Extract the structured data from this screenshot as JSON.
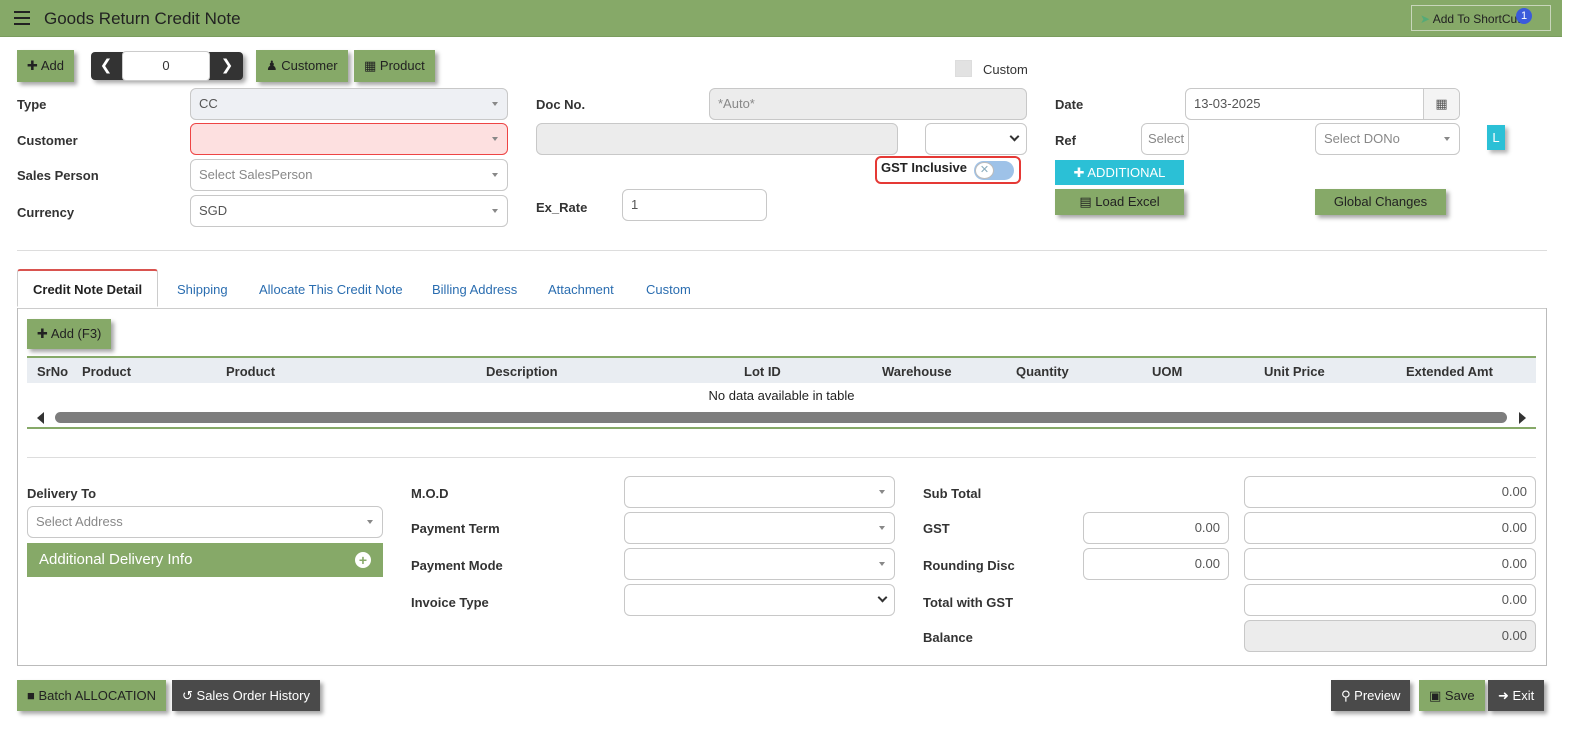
{
  "header": {
    "title": "Goods Return Credit Note",
    "shortcut_label": "Add To ShortCut",
    "shortcut_badge": "1"
  },
  "toolbar": {
    "add_label": "Add",
    "nav_value": "0",
    "customer_label": "Customer",
    "product_label": "Product",
    "custom_label": "Custom"
  },
  "form": {
    "type_label": "Type",
    "type_value": "CC",
    "customer_label": "Customer",
    "sales_person_label": "Sales Person",
    "sales_person_placeholder": "Select SalesPerson",
    "currency_label": "Currency",
    "currency_value": "SGD",
    "doc_no_label": "Doc No.",
    "doc_no_value": "*Auto*",
    "gst_inclusive_label": "GST Inclusive",
    "ex_rate_label": "Ex_Rate",
    "ex_rate_value": "1",
    "date_label": "Date",
    "date_value": "13-03-2025",
    "ref_label": "Ref",
    "ref_select_placeholder": "Select",
    "dono_placeholder": "Select DONo",
    "l_button": "L",
    "additional_label": "ADDITIONAL",
    "load_excel_label": "Load Excel",
    "global_changes_label": "Global Changes"
  },
  "tabs": [
    {
      "label": "Credit Note Detail",
      "active": true
    },
    {
      "label": "Shipping"
    },
    {
      "label": "Allocate This Credit Note"
    },
    {
      "label": "Billing Address"
    },
    {
      "label": "Attachment"
    },
    {
      "label": "Custom"
    }
  ],
  "detail": {
    "add_label": "Add (F3)",
    "columns": [
      "SrNo",
      "Product",
      "Product",
      "Description",
      "Lot ID",
      "Warehouse",
      "Quantity",
      "UOM",
      "Unit Price",
      "Extended Amt"
    ],
    "empty_text": "No data available in table"
  },
  "footer": {
    "delivery_to_label": "Delivery To",
    "address_placeholder": "Select Address",
    "additional_delivery_label": "Additional Delivery Info",
    "mod_label": "M.O.D",
    "payment_term_label": "Payment Term",
    "payment_mode_label": "Payment Mode",
    "invoice_type_label": "Invoice Type",
    "sub_total_label": "Sub Total",
    "sub_total_value": "0.00",
    "gst_label": "GST",
    "gst_pct_value": "0.00",
    "gst_value": "0.00",
    "rounding_label": "Rounding Disc",
    "rounding_pct_value": "0.00",
    "rounding_value": "0.00",
    "total_gst_label": "Total with GST",
    "total_gst_value": "0.00",
    "balance_label": "Balance",
    "balance_value": "0.00"
  },
  "bottom": {
    "batch_label": "Batch ALLOCATION",
    "history_label": "Sales Order History",
    "preview_label": "Preview",
    "save_label": "Save",
    "exit_label": "Exit"
  },
  "colors": {
    "accent_green": "#86a968",
    "dark": "#4a4a4a",
    "cyan": "#2bc0d6",
    "error": "#e53935"
  }
}
